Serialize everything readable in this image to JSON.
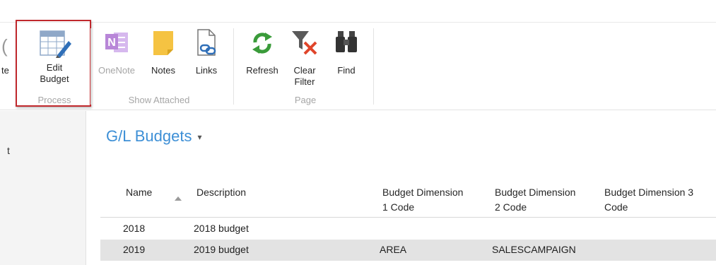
{
  "ribbon": {
    "partial_label": "te",
    "edit_budget": {
      "label": "Edit\nBudget",
      "icon": "grid-edit-icon"
    },
    "process_group": "Process",
    "onenote": {
      "label": "OneNote",
      "icon": "onenote-icon"
    },
    "notes": {
      "label": "Notes",
      "icon": "note-icon"
    },
    "links": {
      "label": "Links",
      "icon": "link-icon"
    },
    "show_attached_group": "Show Attached",
    "refresh": {
      "label": "Refresh",
      "icon": "refresh-icon"
    },
    "clear_filter": {
      "label": "Clear\nFilter",
      "icon": "clear-filter-icon"
    },
    "find": {
      "label": "Find",
      "icon": "binoculars-icon"
    },
    "page_group": "Page"
  },
  "nav": {
    "item": "t"
  },
  "page": {
    "title": "G/L Budgets",
    "caret": "▾"
  },
  "table": {
    "columns": [
      {
        "label": "Name"
      },
      {
        "label": "Description"
      },
      {
        "label": "Budget Dimension\n1 Code"
      },
      {
        "label": "Budget Dimension\n2 Code"
      },
      {
        "label": "Budget Dimension 3\nCode"
      }
    ],
    "rows": [
      {
        "name": "2018",
        "description": "2018 budget",
        "dim1": "",
        "dim2": "",
        "dim3": "",
        "selected": false
      },
      {
        "name": "2019",
        "description": "2019 budget",
        "dim1": "AREA",
        "dim2": "SALESCAMPAIGN",
        "dim3": "",
        "selected": true
      }
    ]
  },
  "colors": {
    "accent": "#3d8fd6",
    "highlight": "#c0282d",
    "selected_row": "#e3e3e3",
    "refresh_green": "#3a9b3a",
    "filter_x": "#e0452a",
    "note_yellow": "#f5c342",
    "onenote_purple": "#b886d8"
  }
}
